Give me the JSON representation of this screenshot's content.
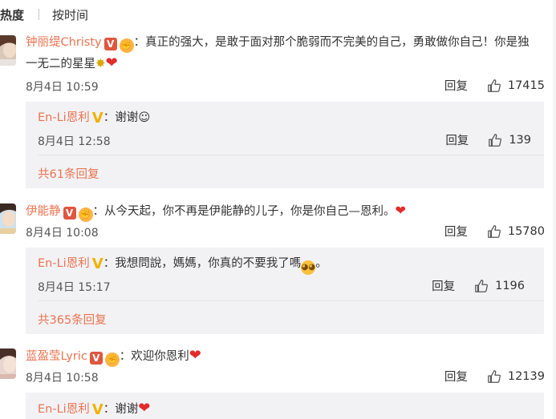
{
  "sort": {
    "hot_label": "热度",
    "time_label": "按时间"
  },
  "comments": [
    {
      "user": "钟丽缇Christy",
      "text_line1": "：真正的强大，是敢于面对那个脆弱而不完美的自己，勇敢做你自己！你是独",
      "text_line2": "一无二的星星",
      "time": "8月4日 10:59",
      "reply_label": "回复",
      "likes": "17415",
      "reply": {
        "user": "En-Li恩利",
        "text": "：谢谢☺",
        "time": "8月4日 12:58",
        "reply_label": "回复",
        "likes": "139"
      },
      "more_replies": "共61条回复"
    },
    {
      "user": "伊能静",
      "text_line1": "：从今天起，你不再是伊能静的儿子，你是你自己—恩利。",
      "time": "8月4日 10:08",
      "reply_label": "回复",
      "likes": "15780",
      "reply": {
        "user": "En-Li恩利",
        "text": "：我想問說，媽媽，你真的不要我了嗎",
        "text_tail": "。",
        "time": "8月4日 15:17",
        "reply_label": "回复",
        "likes": "1196"
      },
      "more_replies": "共365条回复"
    },
    {
      "user": "蓝盈莹Lyric",
      "text_line1": "：欢迎你恩利",
      "time": "8月4日 10:58",
      "reply_label": "回复",
      "likes": "12139",
      "reply": {
        "user": "En-Li恩利",
        "text": "：谢谢"
      }
    }
  ],
  "colors": {
    "name": "#eb7350",
    "reply_bg": "#f2f2f5",
    "heart": "#e22b2b"
  }
}
